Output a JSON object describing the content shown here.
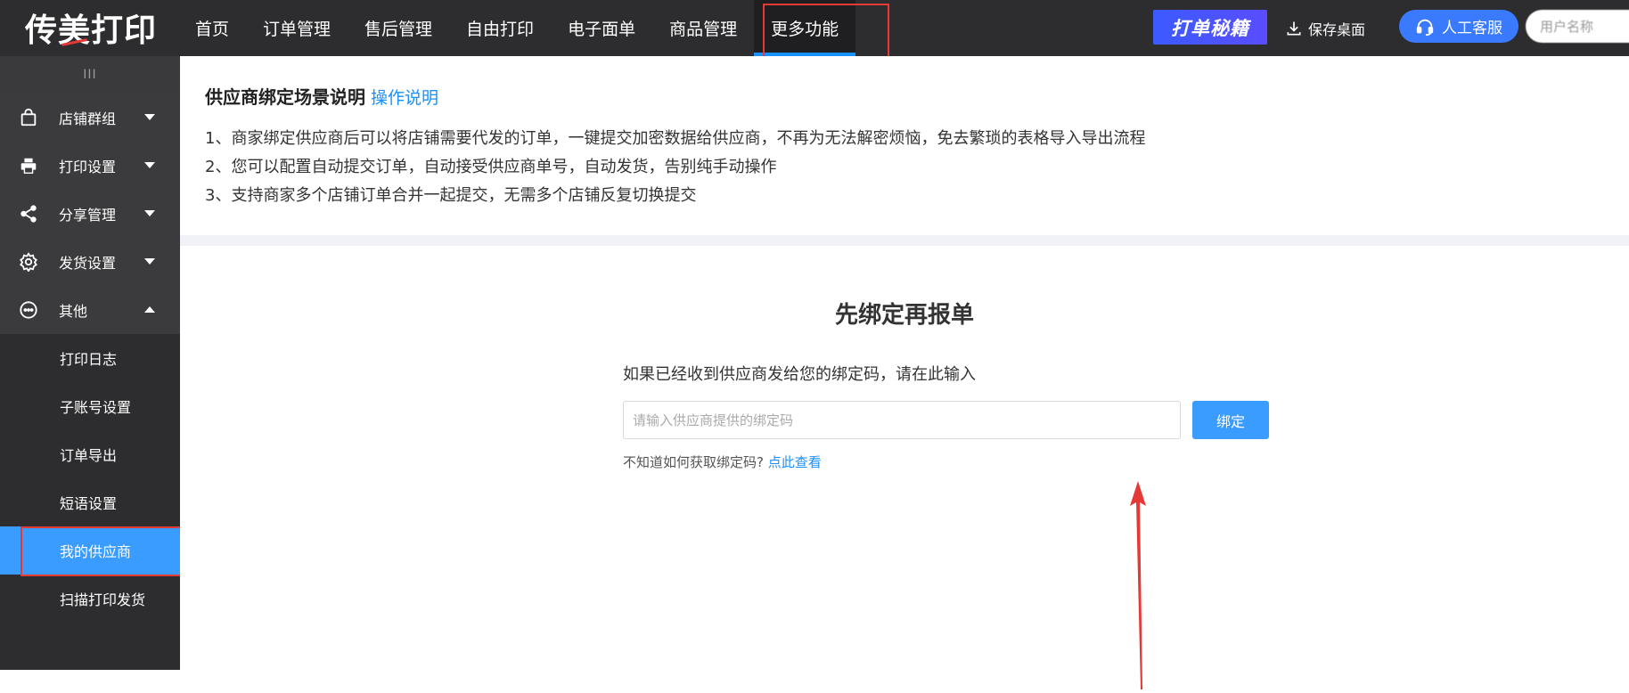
{
  "header": {
    "logo_left": "传",
    "logo_mid": "美",
    "logo_right": "打印",
    "nav": [
      "首页",
      "订单管理",
      "售后管理",
      "自由打印",
      "电子面单",
      "商品管理",
      "更多功能"
    ],
    "active_nav": "更多功能",
    "secret_label": "打单秘籍",
    "save_desktop_label": "保存桌面",
    "service_label": "人工客服",
    "user_label": "用户名称",
    "icons": [
      "download-icon",
      "headset-icon"
    ]
  },
  "sidebar": {
    "collapse_label": "III",
    "groups": [
      {
        "label": "店铺群组",
        "icon": "shop-bag-icon",
        "expanded": false
      },
      {
        "label": "打印设置",
        "icon": "printer-icon",
        "expanded": false
      },
      {
        "label": "分享管理",
        "icon": "share-icon",
        "expanded": false
      },
      {
        "label": "发货设置",
        "icon": "gear-icon",
        "expanded": false
      },
      {
        "label": "其他",
        "icon": "more-icon",
        "expanded": true
      }
    ],
    "subitems": [
      "打印日志",
      "子账号设置",
      "订单导出",
      "短语设置",
      "我的供应商",
      "扫描打印发货"
    ],
    "active_sub": "我的供应商"
  },
  "main": {
    "intro_title": "供应商绑定场景说明",
    "intro_link": "操作说明",
    "intro_lines": [
      "1、商家绑定供应商后可以将店铺需要代发的订单，一键提交加密数据给供应商，不再为无法解密烦恼，免去繁琐的表格导入导出流程",
      "2、您可以配置自动提交订单，自动接受供应商单号，自动发货，告别纯手动操作",
      "3、支持商家多个店铺订单合并一起提交，无需多个店铺反复切换提交"
    ],
    "bind_title": "先绑定再报单",
    "bind_hint": "如果已经收到供应商发给您的绑定码，请在此输入",
    "bind_input_value": "",
    "bind_input_placeholder": "请输入供应商提供的绑定码",
    "bind_button": "绑定",
    "help_text": "不知道如何获取绑定码?",
    "help_link": "点此查看"
  },
  "colors": {
    "topbar": "#2d2d2f",
    "accent": "#1890ff",
    "active_sub": "#3b9cff",
    "highlight": "#e53935"
  }
}
